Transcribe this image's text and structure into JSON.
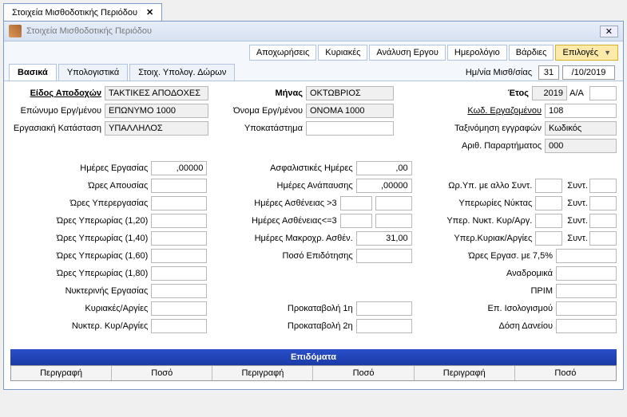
{
  "outerTab": {
    "title": "Στοιχεία Μισθοδοτικής Περιόδου"
  },
  "window": {
    "title": "Στοιχεία Μισθοδοτικής Περιόδου",
    "close": "✕"
  },
  "toolbar": {
    "btns": [
      "Αποχωρήσεις",
      "Κυριακές",
      "Ανάλυση Εργου",
      "Ημερολόγιο",
      "Βάρδιες"
    ],
    "options": "Επιλογές"
  },
  "innerTabs": {
    "t1": "Βασικά",
    "t2": "Υπολογιστικά",
    "t3": "Στοιχ. Υπολογ. Δώρων",
    "dateLabel": "Ημ/νία Μισθ/σίας",
    "day": "31",
    "rest": "/10/2019"
  },
  "top": {
    "eidos_l": "Είδος Αποδοχών",
    "eidos_v": "ΤΑΚΤΙΚΕΣ ΑΠΟΔΟΧΕΣ",
    "minas_l": "Μήνας",
    "minas_v": "ΟΚΤΩΒΡΙΟΣ",
    "etos_l": "Έτος",
    "etos_v": "2019",
    "aa_l": "A/A",
    "epon_l": "Επώνυμο Εργ/μένου",
    "epon_v": "ΕΠΩΝΥΜΟ 1000",
    "onoma_l": "Όνομα Εργ/μένου",
    "onoma_v": "ΟΝΟΜΑ 1000",
    "kod_l": "Κωδ. Εργαζομένου",
    "kod_v": "108",
    "erg_l": "Εργασιακή Κατάσταση",
    "erg_v": "ΥΠΑΛΛΗΛΟΣ",
    "ypok_l": "Υποκατάστημα",
    "tax_l": "Ταξινόμηση εγγραφών",
    "tax_v": "Κωδικός",
    "arp_l": "Αριθ. Παραρτήματος",
    "arp_v": "000"
  },
  "left": {
    "l1": "Ημέρες Εργασίας",
    "v1": ",00000",
    "l2": "Ώρες Απουσίας",
    "l3": "Ώρες Υπερεργασίας",
    "l4": "Ώρες Υπερωρίας (1,20)",
    "l5": "Ώρες Υπερωρίας (1,40)",
    "l6": "Ώρες Υπερωρίας (1,60)",
    "l7": "Ώρες Υπερωρίας (1,80)",
    "l8": "Νυκτερινής Εργασίας",
    "l9": "Κυριακές/Αργίες",
    "l10": "Νυκτερ. Κυρ/Αργίες"
  },
  "mid": {
    "l1": "Ασφαλιστικές Ημέρες",
    "v1": ",00",
    "l2": "Ημέρες Ανάπαυσης",
    "v2": ",00000",
    "l3": "Ημέρες Ασθένειας >3",
    "l4": "Ημέρες Ασθένειας<=3",
    "l5": "Ημέρες Μακροχρ. Ασθέν.",
    "v5": "31,00",
    "l6": "Ποσό Επιδότησης",
    "l7": "Προκαταβολή 1η",
    "l8": "Προκαταβολή 2η"
  },
  "right": {
    "l1": "Ωρ.Υπ. με αλλο Συντ.",
    "s": "Συντ.",
    "l2": "Υπερωρίες Νύκτας",
    "l3": "Υπερ. Νυκτ. Κυρ/Αργ.",
    "l4": "Υπερ.Κυριακ/Αργίες",
    "l5": "Ώρες Εργασ. με 7,5%",
    "l6": "Αναδρομικά",
    "l7": "ΠΡΙΜ",
    "l8": "Επ. Ισολογισμού",
    "l9": "Δόση Δανείου"
  },
  "section": {
    "title": "Επιδόματα"
  },
  "grid": {
    "c1": "Περιγραφή",
    "c2": "Ποσό",
    "c3": "Περιγραφή",
    "c4": "Ποσό",
    "c5": "Περιγραφή",
    "c6": "Ποσό"
  }
}
